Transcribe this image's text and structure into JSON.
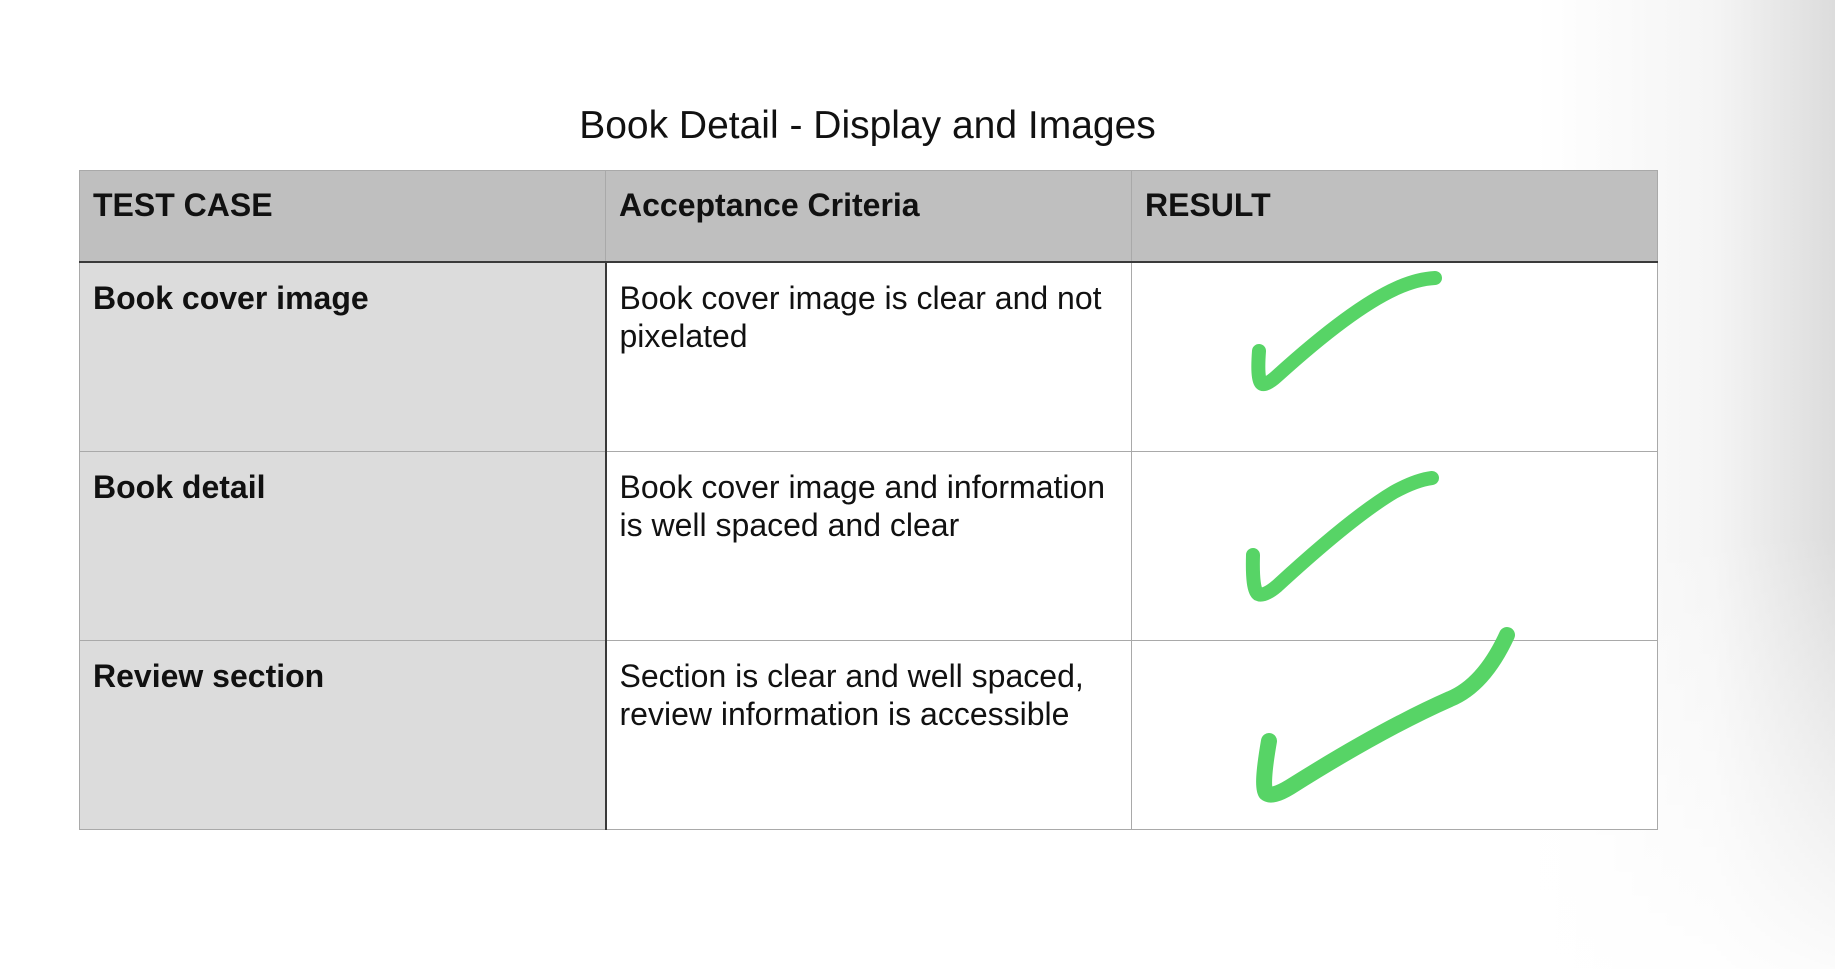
{
  "document": {
    "title": "Book Detail - Display and Images"
  },
  "table": {
    "headers": [
      "TEST CASE",
      "Acceptance Criteria",
      "RESULT"
    ],
    "rows": [
      {
        "test_case": "Book cover image",
        "criteria": "Book cover image is clear and not pixelated",
        "result": "passed"
      },
      {
        "test_case": "Book detail",
        "criteria": "Book cover image and information is well spaced and clear",
        "result": "passed"
      },
      {
        "test_case": "Review section",
        "criteria": "Section is clear and well spaced, review information is accessible",
        "result": "passed"
      }
    ]
  },
  "colors": {
    "check_mark": "#57d466",
    "header_bg": "#bfbfbf",
    "case_bg": "#dcdcdc"
  },
  "icons": {
    "result_mark": "check-mark-icon"
  }
}
